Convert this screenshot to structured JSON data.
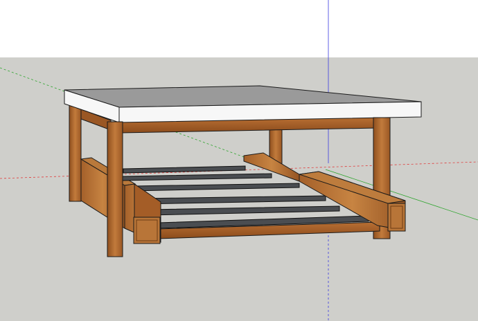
{
  "scene": {
    "sky_color": "#ffffff",
    "ground_color": "#cfcfcb",
    "axis_colors": {
      "red": "#e03c3c",
      "green": "#2ca52c",
      "blue": "#3a3ae0"
    },
    "materials": {
      "tabletop_top": "#9a9a9a",
      "tabletop_edge": "#f7f7f7",
      "wood_light": "#c77f3e",
      "wood_mid": "#a9622a",
      "wood_dark": "#7a4318",
      "steel": "#4a4d51",
      "edge": "#1a1a1a"
    }
  }
}
